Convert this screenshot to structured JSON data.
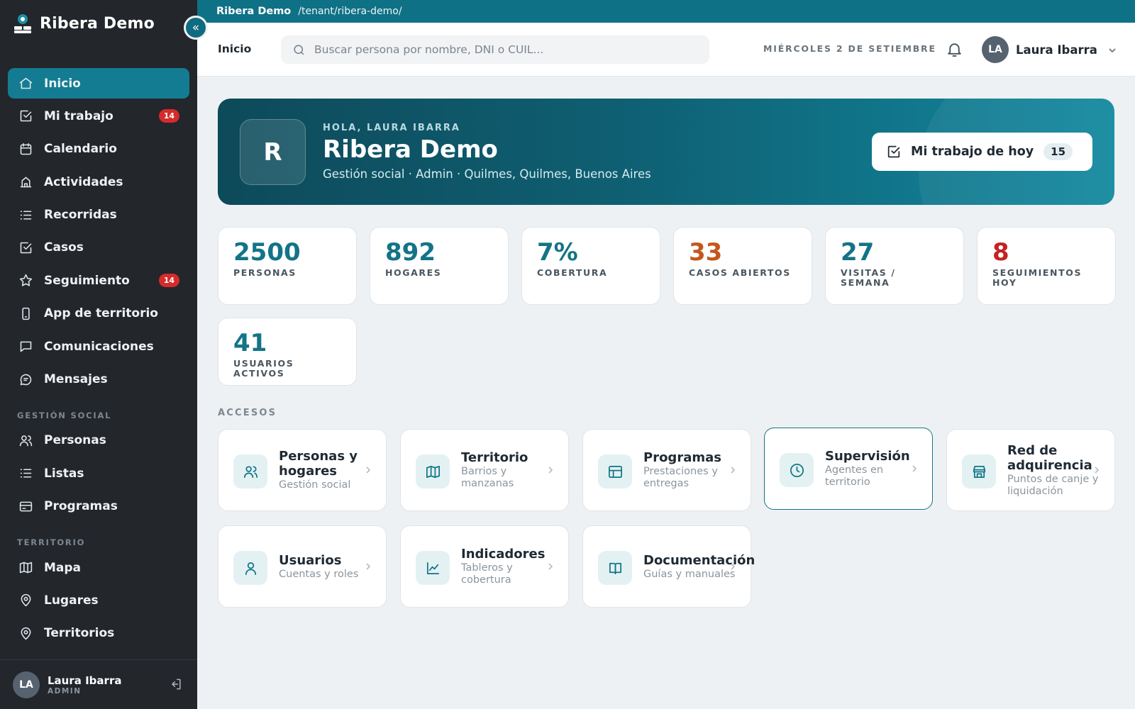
{
  "app": {
    "brand": "Ribera Demo",
    "collapse_glyph": "«",
    "tenant_name": "Ribera Demo",
    "tenant_path": "/tenant/ribera-demo/"
  },
  "sidebar": {
    "items": [
      {
        "label": "Inicio",
        "icon": "home-icon",
        "active": true
      },
      {
        "label": "Mi trabajo",
        "icon": "checkbox-icon",
        "badge": "14"
      },
      {
        "label": "Calendario",
        "icon": "calendar-icon"
      },
      {
        "label": "Actividades",
        "icon": "building-icon"
      },
      {
        "label": "Recorridas",
        "icon": "list-icon"
      },
      {
        "label": "Casos",
        "icon": "checkbox-icon"
      },
      {
        "label": "Seguimiento",
        "icon": "star-icon",
        "badge": "14"
      },
      {
        "label": "App de territorio",
        "icon": "phone-icon"
      },
      {
        "label": "Comunicaciones",
        "icon": "chat-icon"
      },
      {
        "label": "Mensajes",
        "icon": "message-icon"
      }
    ],
    "section_social": "GESTIÓN SOCIAL",
    "social_items": [
      {
        "label": "Personas",
        "icon": "users-icon"
      },
      {
        "label": "Listas",
        "icon": "list-icon"
      },
      {
        "label": "Programas",
        "icon": "card-icon"
      }
    ],
    "section_territorio": "TERRITORIO",
    "territorio_items": [
      {
        "label": "Mapa",
        "icon": "map-icon"
      },
      {
        "label": "Lugares",
        "icon": "pin-icon"
      },
      {
        "label": "Territorios",
        "icon": "pin-icon"
      }
    ],
    "footer": {
      "initials": "LA",
      "name": "Laura Ibarra",
      "role": "ADMIN"
    }
  },
  "header": {
    "breadcrumb": "Inicio",
    "search_placeholder": "Buscar persona por nombre, DNI o CUIL...",
    "date": "MIÉRCOLES 2 DE SETIEMBRE",
    "user_initials": "LA",
    "user_name": "Laura Ibarra"
  },
  "hero": {
    "logo_letter": "R",
    "greeting": "HOLA, LAURA IBARRA",
    "title": "Ribera Demo",
    "subtitle": "Gestión social · Admin · Quilmes, Quilmes, Buenos Aires",
    "button_label": "Mi trabajo de hoy",
    "button_count": "15"
  },
  "stats": [
    {
      "value": "2500",
      "label": "PERSONAS",
      "color": "#137486"
    },
    {
      "value": "892",
      "label": "HOGARES",
      "color": "#137486"
    },
    {
      "value": "7%",
      "label": "COBERTURA",
      "color": "#137486"
    },
    {
      "value": "33",
      "label": "CASOS ABIERTOS",
      "color": "#c4571b"
    },
    {
      "value": "27",
      "label": "VISITAS / SEMANA",
      "color": "#137486"
    },
    {
      "value": "8",
      "label": "SEGUIMIENTOS HOY",
      "color": "#c42222"
    },
    {
      "value": "41",
      "label": "USUARIOS ACTIVOS",
      "color": "#137486"
    }
  ],
  "accesos": {
    "label": "ACCESOS",
    "cards": [
      {
        "title": "Personas y hogares",
        "subtitle": "Gestión social",
        "icon": "users-icon"
      },
      {
        "title": "Territorio",
        "subtitle": "Barrios y manzanas",
        "icon": "map-icon"
      },
      {
        "title": "Programas",
        "subtitle": "Prestaciones y entregas",
        "icon": "table-icon"
      },
      {
        "title": "Supervisión",
        "subtitle": "Agentes en territorio",
        "icon": "clock-icon",
        "selected": true
      },
      {
        "title": "Red de adquirencia",
        "subtitle": "Puntos de canje y liquidación",
        "icon": "store-icon"
      },
      {
        "title": "Usuarios",
        "subtitle": "Cuentas y roles",
        "icon": "user-icon"
      },
      {
        "title": "Indicadores",
        "subtitle": "Tableros y cobertura",
        "icon": "chart-icon"
      },
      {
        "title": "Documentación",
        "subtitle": "Guías y manuales",
        "icon": "book-icon"
      }
    ]
  },
  "colors": {
    "accent": "#137486",
    "sidebar_bg": "#23262b",
    "topstrip": "#0f7186",
    "badge": "#d52b2b"
  }
}
